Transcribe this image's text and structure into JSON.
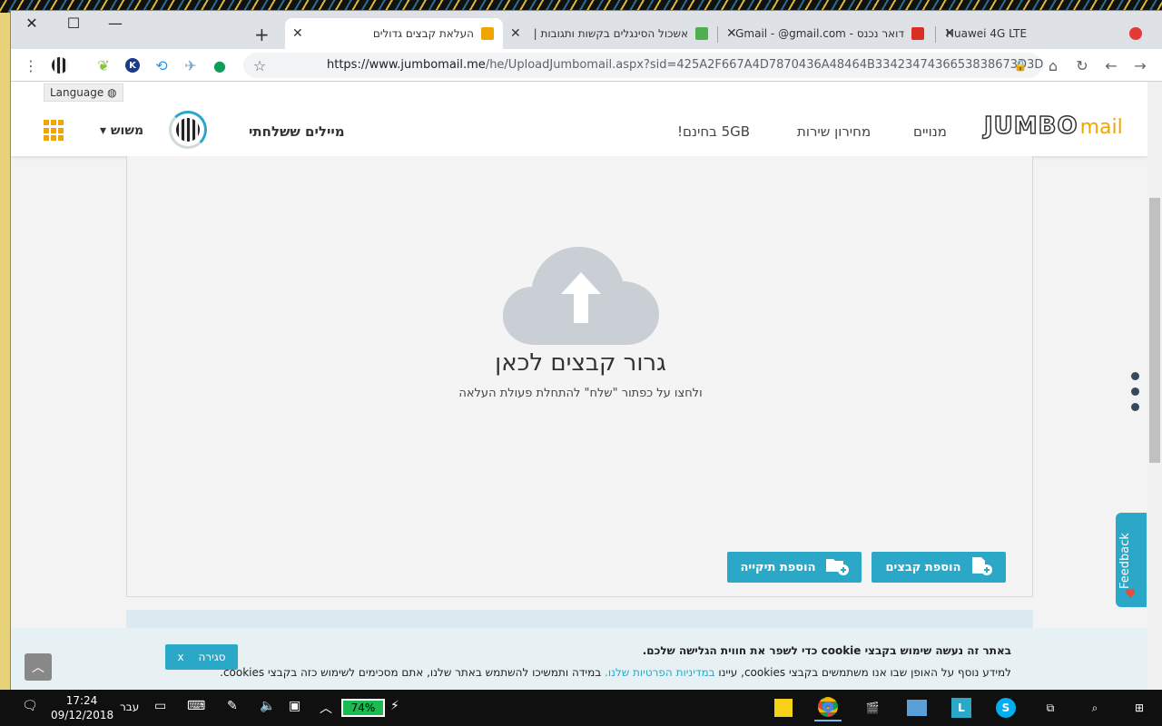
{
  "browser": {
    "tabs": [
      {
        "title": "העלאת קבצים גדולים",
        "active": true,
        "icon_color": "#f0a500"
      },
      {
        "title": "אשכול הסינגלים בקשות ותגובות |",
        "active": false,
        "icon_color": "#4caf50"
      },
      {
        "title": "דואר נכנס - Gmail - @gmail.com",
        "active": false,
        "icon_color": "#d93025"
      },
      {
        "title": "Huawei 4G LTE",
        "active": false,
        "icon_color": "#e53935"
      }
    ],
    "url_host": "https://www.jumbomail.me",
    "url_path": "/he/UploadJumbomail.aspx?sid=425A2F667A4D7870436A48464B3342347436653838673D3D"
  },
  "site": {
    "language_label": "Language",
    "user_label": "משוש",
    "my_mails": "מיילים ששלחתי",
    "nav": {
      "free": "5GB בחינם!",
      "pricing": "מחירון שירות",
      "subscriptions": "מנויים"
    },
    "logo_main": "JUMBO",
    "logo_sub": "mail"
  },
  "upload": {
    "title": "גרור קבצים לכאן",
    "subtitle": "ולחצו על כפתור \"שלח\" להתחלת פעולת העלאה",
    "add_files": "הוספת קבצים",
    "add_folder": "הוספת תיקייה"
  },
  "feedback_label": "Feedback",
  "cookie": {
    "title": "באתר זה נעשה שימוש בקבצי cookie כדי לשפר את חווית הגלישה שלכם.",
    "text_before": "למידע נוסף על האופן שבו אנו משתמשים בקבצי cookies, עיינו ",
    "link": "במדיניות הפרטיות שלנו.",
    "text_after": " במידה ותמשיכו להשתמש באתר שלנו, אתם מסכימים לשימוש כזה בקבצי cookies.",
    "close_label": "סגירה",
    "close_x": "x"
  },
  "taskbar": {
    "time": "17:24",
    "date": "09/12/2018",
    "lang": "עבר",
    "battery": "74%"
  },
  "colors": {
    "accent": "#2ba8c8",
    "brand_orange": "#f0a500"
  }
}
